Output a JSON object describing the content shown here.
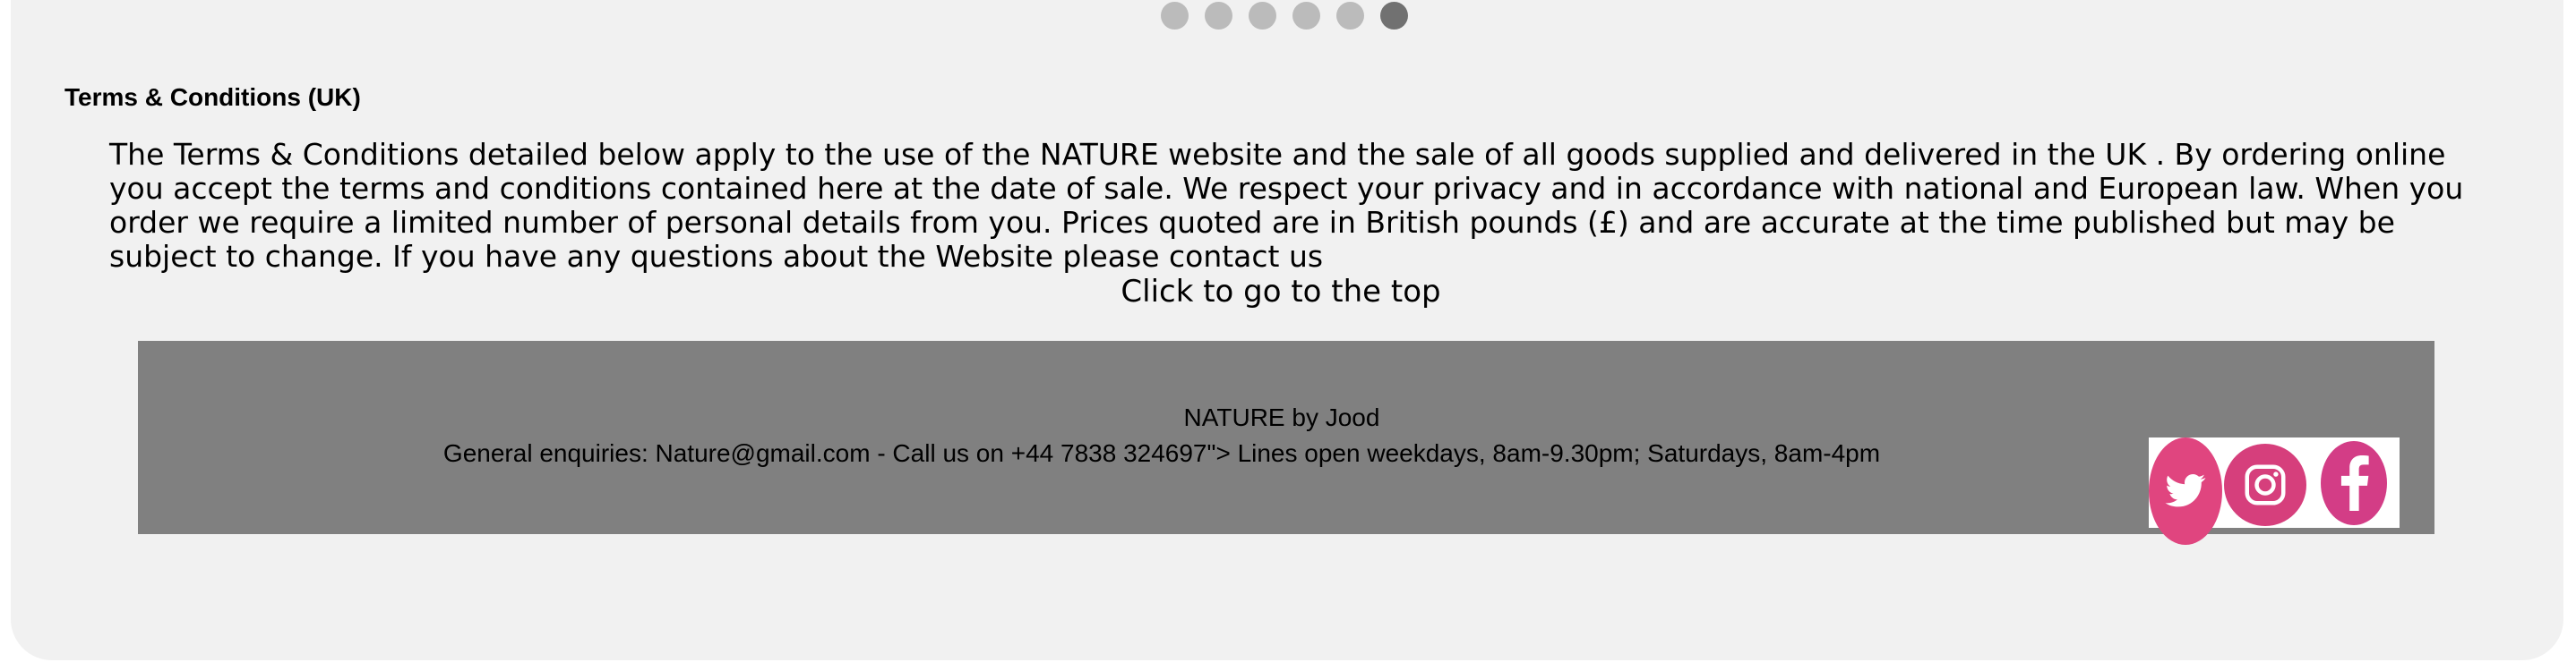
{
  "slideshow": {
    "dots": [
      {
        "label": "slide 1",
        "active": false
      },
      {
        "label": "slide 2",
        "active": false
      },
      {
        "label": "slide 3",
        "active": false
      },
      {
        "label": "slide 4",
        "active": false
      },
      {
        "label": "slide 5",
        "active": false
      },
      {
        "label": "slide 6",
        "active": true
      }
    ]
  },
  "terms": {
    "heading": "Terms & Conditions (UK)",
    "body": "The Terms & Conditions detailed below apply to the use of the NATURE website and the sale of all goods supplied and delivered in the UK . By ordering online you accept the terms and conditions contained here at the date of sale. We respect your privacy and in accordance with national and European law. When you order we require a limited number of personal details from you. Prices quoted are in British pounds (£) and are accurate at the time published but may be subject to change. If you have any questions about the Website please contact us"
  },
  "top_link": "Click to go to the top",
  "footer": {
    "brand": "NATURE by Jood",
    "contact": "General enquiries: Nature@gmail.com - Call us on +44 7838 324697\"> Lines open weekdays, 8am-9.30pm; Saturdays, 8am-4pm",
    "social": [
      {
        "name": "twitter",
        "icon": "twitter-icon",
        "color": "#e0457f"
      },
      {
        "name": "instagram",
        "icon": "instagram-icon",
        "color": "#d63f7c"
      },
      {
        "name": "facebook",
        "icon": "facebook-icon",
        "color": "#d33d86"
      }
    ]
  },
  "colors": {
    "page_background": "#f1f1f1",
    "footer_background": "#808080",
    "dot_inactive": "#bbbbbb",
    "dot_active": "#717171"
  }
}
